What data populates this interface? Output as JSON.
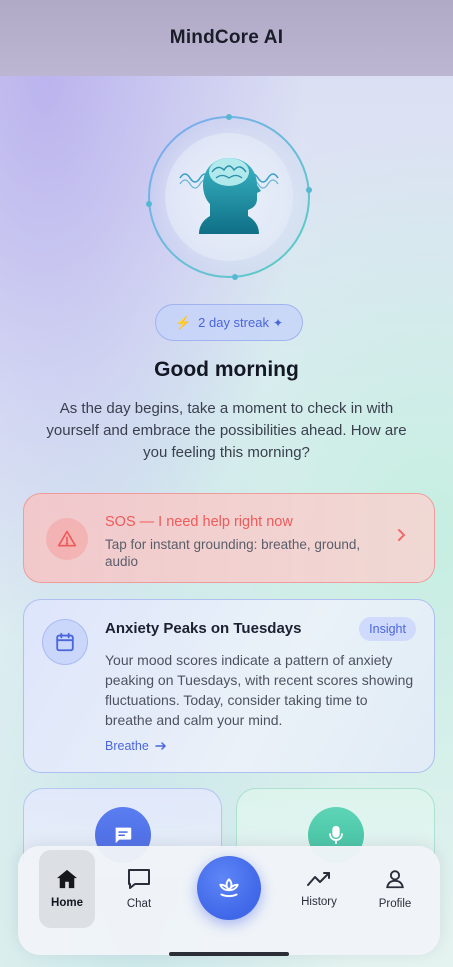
{
  "header": {
    "title": "MindCore AI"
  },
  "hero": {
    "icon": "head-with-brainwaves-icon"
  },
  "streak": {
    "label": "2 day streak",
    "icon": "bolt-icon",
    "trail_icon": "sparkle-icon"
  },
  "greeting": {
    "title": "Good morning",
    "message": "As the day begins, take a moment to check in with yourself and embrace the possibilities ahead. How are you feeling this morning?"
  },
  "sos": {
    "title": "SOS — I need help right now",
    "subtitle": "Tap for instant grounding: breathe, ground, audio",
    "icon": "warning-triangle-icon"
  },
  "insight": {
    "title": "Anxiety Peaks on Tuesdays",
    "badge": "Insight",
    "body": "Your mood scores indicate a pattern of anxiety peaking on Tuesdays, with recent scores showing fluctuations. Today, consider taking time to breathe and calm your mind.",
    "link": "Breathe",
    "icon": "calendar-icon"
  },
  "quick_actions": [
    {
      "icon": "chat-icon",
      "color": "#4a68e2"
    },
    {
      "icon": "microphone-icon",
      "color": "#3fbf9e"
    }
  ],
  "tabbar": {
    "items": [
      {
        "label": "Home",
        "icon": "home-icon",
        "active": true
      },
      {
        "label": "Chat",
        "icon": "chat-icon",
        "active": false
      },
      {
        "label": "",
        "icon": "lotus-icon",
        "active": false
      },
      {
        "label": "History",
        "icon": "trend-icon",
        "active": false
      },
      {
        "label": "Profile",
        "icon": "user-icon",
        "active": false
      }
    ]
  },
  "colors": {
    "accent": "#4a66dc",
    "sos": "#ef5a5a",
    "teal": "#3fbf9e"
  }
}
